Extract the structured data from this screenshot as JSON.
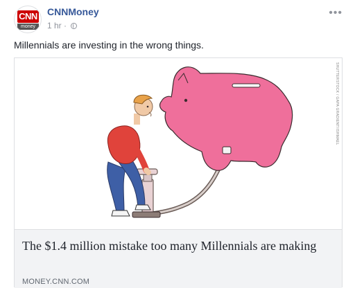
{
  "post": {
    "page_name": "CNNMoney",
    "avatar": {
      "top_text": "CNN",
      "bottom_text": "money"
    },
    "time": "1 hr",
    "separator": "·",
    "more_label": "•••",
    "text": "Millennials are investing in the wrong things."
  },
  "link": {
    "image_credit": "SHUTTERSTOCK / GAPA GRADIENT/ISHMAEL",
    "title": "The $1.4 million mistake too many Millennials are making",
    "domain": "MONEY.CNN.COM"
  },
  "colors": {
    "brand_red": "#cc0000",
    "link_blue": "#365899",
    "piggy_pink": "#ef6f9b"
  }
}
